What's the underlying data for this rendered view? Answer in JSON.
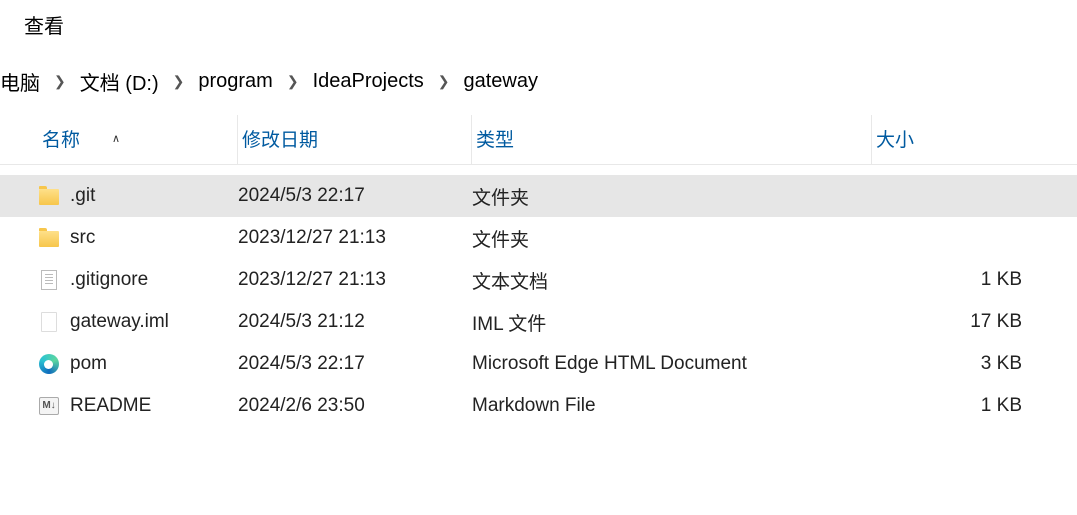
{
  "menu": {
    "view": "查看"
  },
  "breadcrumb": {
    "items": [
      "电脑",
      "文档 (D:)",
      "program",
      "IdeaProjects",
      "gateway"
    ],
    "separator": "❯"
  },
  "columns": {
    "name": "名称",
    "date": "修改日期",
    "type": "类型",
    "size": "大小",
    "sort_indicator": "∧"
  },
  "files": [
    {
      "name": ".git",
      "date": "2024/5/3 22:17",
      "type": "文件夹",
      "size": "",
      "icon": "folder",
      "selected": true
    },
    {
      "name": "src",
      "date": "2023/12/27 21:13",
      "type": "文件夹",
      "size": "",
      "icon": "folder"
    },
    {
      "name": ".gitignore",
      "date": "2023/12/27 21:13",
      "type": "文本文档",
      "size": "1 KB",
      "icon": "text"
    },
    {
      "name": "gateway.iml",
      "date": "2024/5/3 21:12",
      "type": "IML 文件",
      "size": "17 KB",
      "icon": "blank"
    },
    {
      "name": "pom",
      "date": "2024/5/3 22:17",
      "type": "Microsoft Edge HTML Document",
      "size": "3 KB",
      "icon": "edge"
    },
    {
      "name": "README",
      "date": "2024/2/6 23:50",
      "type": "Markdown File",
      "size": "1 KB",
      "icon": "md"
    }
  ]
}
